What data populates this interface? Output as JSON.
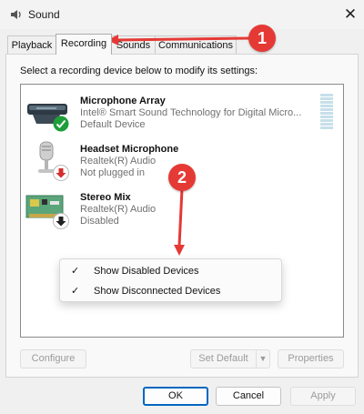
{
  "window": {
    "title": "Sound",
    "close_glyph": "✕",
    "icon": "speaker-icon"
  },
  "tabs": [
    {
      "label": "Playback",
      "active": false
    },
    {
      "label": "Recording",
      "active": true
    },
    {
      "label": "Sounds",
      "active": false
    },
    {
      "label": "Communications",
      "active": false
    }
  ],
  "instruction": "Select a recording device below to modify its settings:",
  "devices": [
    {
      "name": "Microphone Array",
      "line1": "Intel® Smart Sound Technology for Digital Micro...",
      "line2": "Default Device",
      "icon": "microphone-array-icon",
      "status_icon": "check-icon",
      "status_color": "#1e9e3a"
    },
    {
      "name": "Headset Microphone",
      "line1": "Realtek(R) Audio",
      "line2": "Not plugged in",
      "icon": "headset-microphone-icon",
      "status_icon": "red-down-arrow-icon",
      "status_color": "#d32f2f"
    },
    {
      "name": "Stereo Mix",
      "line1": "Realtek(R) Audio",
      "line2": "Disabled",
      "icon": "circuit-board-icon",
      "status_icon": "black-down-arrow-icon",
      "status_color": "#222222"
    }
  ],
  "context_menu": [
    {
      "label": "Show Disabled Devices",
      "checked": true,
      "check": "✓"
    },
    {
      "label": "Show Disconnected Devices",
      "checked": true,
      "check": "✓"
    }
  ],
  "buttons": {
    "configure": "Configure",
    "set_default": "Set Default",
    "set_default_arrow": "▼",
    "properties": "Properties",
    "ok": "OK",
    "cancel": "Cancel",
    "apply": "Apply"
  },
  "annotations": [
    {
      "label": "1",
      "color": "#e53935"
    },
    {
      "label": "2",
      "color": "#e53935"
    }
  ]
}
